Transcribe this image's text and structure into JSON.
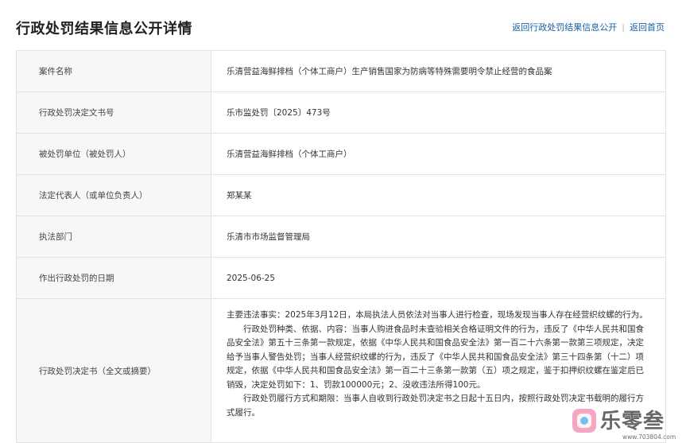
{
  "page": {
    "title": "行政处罚结果信息公开详情",
    "nav_back_list": "返回行政处罚结果信息公开",
    "nav_sep": "|",
    "nav_home": "返回首页"
  },
  "rows": [
    {
      "label": "案件名称",
      "value": "乐清营益海鲜排档（个体工商户）生产销售国家为防病等特殊需要明令禁止经营的食品案"
    },
    {
      "label": "行政处罚决定文书号",
      "value": "乐市监处罚〔2025〕473号"
    },
    {
      "label": "被处罚单位（被处罚人）",
      "value": "乐清营益海鲜排档（个体工商户）"
    },
    {
      "label": "法定代表人（或单位负责人）",
      "value": "郑某某"
    },
    {
      "label": "执法部门",
      "value": "乐清市市场监督管理局"
    },
    {
      "label": "作出行政处罚的日期",
      "value": "2025-06-25"
    }
  ],
  "decision": {
    "label": "行政处罚决定书（全文或摘要）",
    "p1": "主要违法事实：2025年3月12日，本局执法人员依法对当事人进行检查，现场发现当事人存在经营织纹螺的行为。",
    "p2": "行政处罚种类、依据、内容：当事人购进食品时未查验相关合格证明文件的行为，违反了《中华人民共和国食品安全法》第五十三条第一款规定，依据《中华人民共和国食品安全法》第一百二十六条第一款第三项规定，决定给予当事人警告处罚；当事人经营织纹螺的行为，违反了《中华人民共和国食品安全法》第三十四条第（十二）项 规定，依据《中华人民共和国食品安全法》第一百二十三条第一款第（五）项之规定，鉴于扣押织纹螺在鉴定后已销毁，决定处罚如下：1、罚款100000元；2、没收违法所得100元。",
    "p3": "行政处罚履行方式和期限：当事人自收到行政处罚决定书之日起十五日内，按照行政处罚决定书载明的履行方式履行。"
  },
  "watermark": {
    "text": "乐零叁",
    "url": "www.703804.com"
  }
}
